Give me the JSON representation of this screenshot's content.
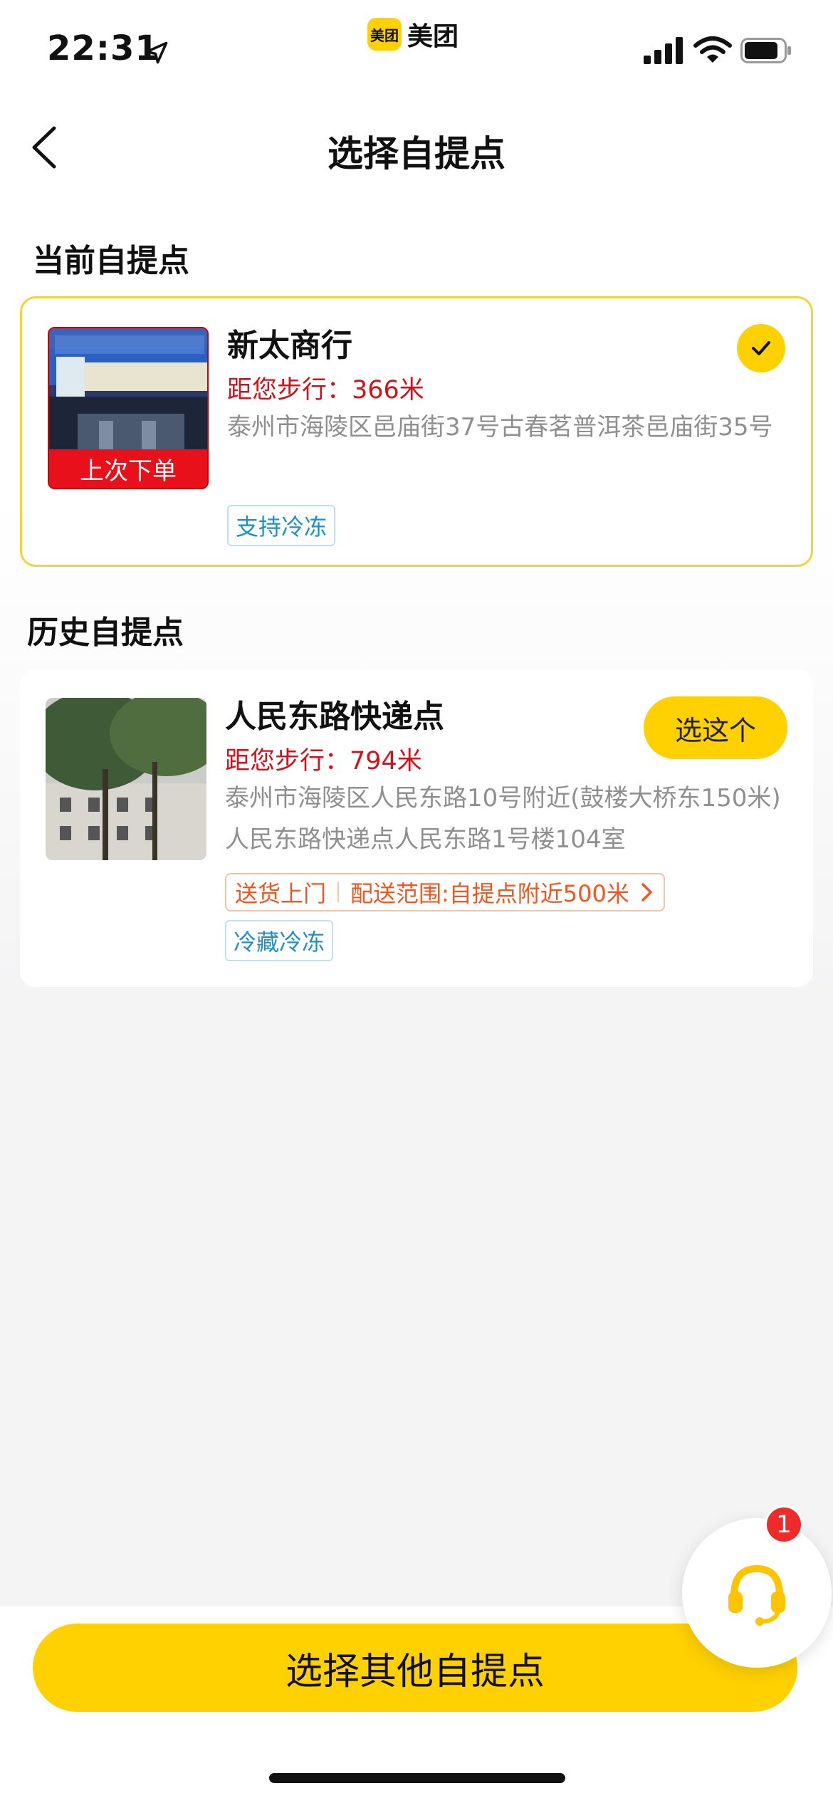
{
  "status_bar": {
    "time": "22:31",
    "brand_logo_text": "美团",
    "brand_name": "美团"
  },
  "nav": {
    "title": "选择自提点"
  },
  "current_section": {
    "title": "当前自提点",
    "card": {
      "thumb_badge": "上次下单",
      "name": "新太商行",
      "distance": "距您步行：366米",
      "address": "泰州市海陵区邑庙街37号古春茗普洱茶邑庙街35号",
      "tag": "支持冷冻",
      "selected": true
    }
  },
  "history_section": {
    "title": "历史自提点",
    "card": {
      "name": "人民东路快递点",
      "distance": "距您步行：794米",
      "address": "泰州市海陵区人民东路10号附近(鼓楼大桥东150米)人民东路快递点人民东路1号楼104室",
      "select_label": "选这个",
      "delivery_label": "送货上门",
      "delivery_range": "配送范围:自提点附近500米",
      "tag": "冷藏冷冻"
    }
  },
  "support": {
    "badge_count": "1"
  },
  "bottom": {
    "button_label": "选择其他自提点"
  },
  "colors": {
    "accent": "#FFD100",
    "distance_red": "#D0121B",
    "tag_blue": "#1f8fc4",
    "delivery_orange": "#F0561F"
  }
}
